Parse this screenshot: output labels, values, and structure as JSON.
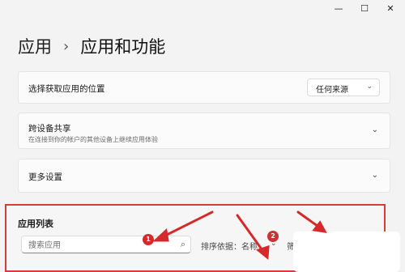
{
  "window": {
    "minimize_glyph": "—",
    "maximize_glyph": "☐",
    "close_glyph": "✕"
  },
  "breadcrumb": {
    "parent": "应用",
    "separator": "›",
    "current": "应用和功能"
  },
  "settings": {
    "install_location": {
      "title": "选择获取应用的位置",
      "value": "任何来源"
    },
    "share_across_devices": {
      "title": "跨设备共享",
      "subtitle": "在连接到你的帐户的其他设备上继续应用体验"
    },
    "more_settings": {
      "title": "更多设置"
    }
  },
  "app_list": {
    "title": "应用列表",
    "search_placeholder": "搜索应用",
    "sort_label": "排序依据：名称",
    "filter_label": "筛选条件",
    "badge_1": "1",
    "badge_2": "2"
  },
  "icons": {
    "chevron": "⌄",
    "search": "⌕"
  },
  "colors": {
    "highlight_border": "#d93a3a",
    "annotation_red": "#d6292b",
    "page_background": "#f3f3f3"
  }
}
